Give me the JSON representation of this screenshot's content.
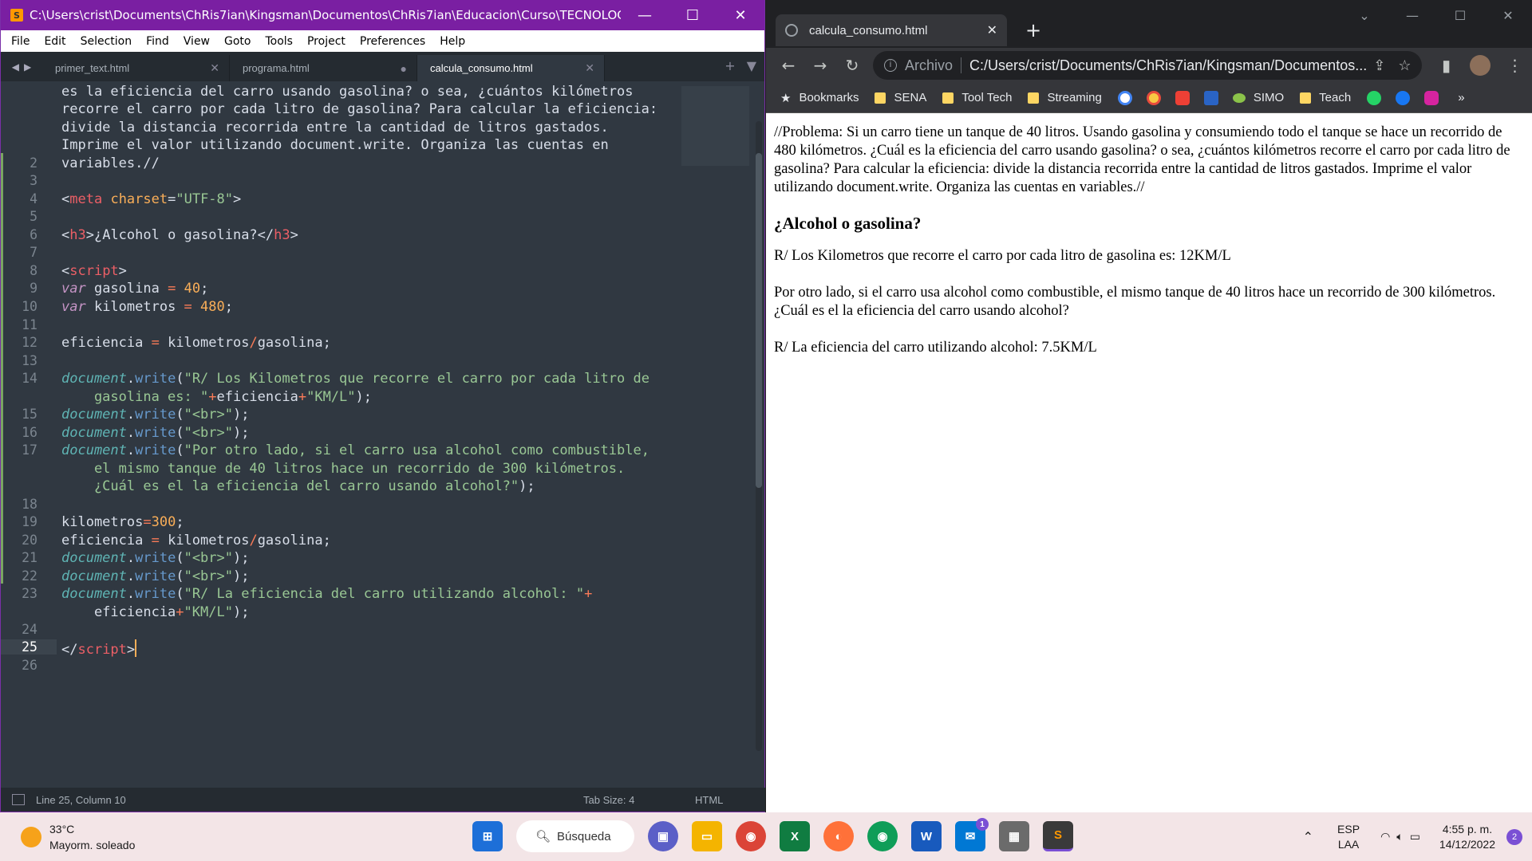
{
  "sublime": {
    "title": "C:\\Users\\crist\\Documents\\ChRis7ian\\Kingsman\\Documentos\\ChRis7ian\\Educacion\\Curso\\TECNOLOGÍAS DE IN...",
    "menu": [
      "File",
      "Edit",
      "Selection",
      "Find",
      "View",
      "Goto",
      "Tools",
      "Project",
      "Preferences",
      "Help"
    ],
    "tabs": [
      "primer_text.html",
      "programa.html",
      "calcula_consumo.html"
    ],
    "code_lines": [
      "es la eficiencia del carro usando gasolina? o sea, ¿cuántos kilómetros",
      "recorre el carro por cada litro de gasolina? Para calcular la eficiencia:",
      "divide la distancia recorrida entre la cantidad de litros gastados.",
      "Imprime el valor utilizando document.write. Organiza las cuentas en",
      "variables.//"
    ],
    "status": {
      "position": "Line 25, Column 10",
      "tab_size": "Tab Size: 4",
      "syntax": "HTML"
    }
  },
  "chrome": {
    "tab_title": "calcula_consumo.html",
    "address_label": "Archivo",
    "url": "C:/Users/crist/Documents/ChRis7ian/Kingsman/Documentos...",
    "bookmarks": [
      "Bookmarks",
      "SENA",
      "Tool Tech",
      "Streaming",
      "SIMO",
      "Teach"
    ],
    "page": {
      "problem": "//Problema: Si un carro tiene un tanque de 40 litros. Usando gasolina y consumiendo todo el tanque se hace un recorrido de 480 kilómetros. ¿Cuál es la eficiencia del carro usando gasolina? o sea, ¿cuántos kilómetros recorre el carro por cada litro de gasolina? Para calcular la eficiencia: divide la distancia recorrida entre la cantidad de litros gastados. Imprime el valor utilizando document.write. Organiza las cuentas en variables.//",
      "heading": "¿Alcohol o gasolina?",
      "answer1": "R/ Los Kilometros que recorre el carro por cada litro de gasolina es: 12KM/L",
      "question2": "Por otro lado, si el carro usa alcohol como combustible, el mismo tanque de 40 litros hace un recorrido de 300 kilómetros. ¿Cuál es el la eficiencia del carro usando alcohol?",
      "answer2": "R/ La eficiencia del carro utilizando alcohol: 7.5KM/L"
    }
  },
  "taskbar": {
    "temp": "33°C",
    "weather": "Mayorm. soleado",
    "search": "Búsqueda",
    "lang1": "ESP",
    "lang2": "LAA",
    "time": "4:55 p. m.",
    "date": "14/12/2022",
    "notif_count": "2",
    "mail_badge": "1"
  }
}
